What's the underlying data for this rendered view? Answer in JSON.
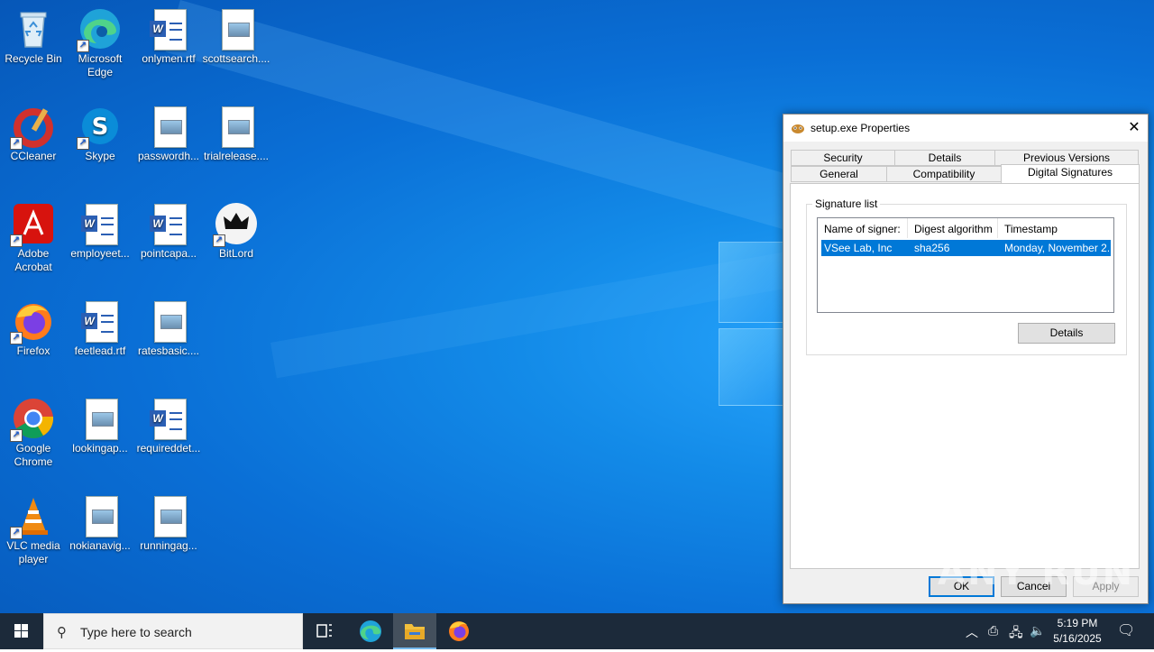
{
  "desktop": {
    "icons": [
      {
        "label": "Recycle Bin",
        "icon": "recycle-bin-icon"
      },
      {
        "label": "Microsoft Edge",
        "icon": "edge-icon"
      },
      {
        "label": "onlymen.rtf",
        "icon": "word-doc-icon"
      },
      {
        "label": "scottsearch....",
        "icon": "image-file-icon"
      },
      {
        "label": "CCleaner",
        "icon": "ccleaner-icon"
      },
      {
        "label": "Skype",
        "icon": "skype-icon"
      },
      {
        "label": "passwordh...",
        "icon": "image-file-icon"
      },
      {
        "label": "trialrelease....",
        "icon": "image-file-icon"
      },
      {
        "label": "Adobe Acrobat",
        "icon": "acrobat-icon"
      },
      {
        "label": "employeet...",
        "icon": "word-doc-icon"
      },
      {
        "label": "pointcapa...",
        "icon": "word-doc-icon"
      },
      {
        "label": "BitLord",
        "icon": "bitlord-icon"
      },
      {
        "label": "Firefox",
        "icon": "firefox-icon"
      },
      {
        "label": "feetlead.rtf",
        "icon": "word-doc-icon"
      },
      {
        "label": "ratesbasic....",
        "icon": "image-file-icon"
      },
      {
        "label": "Google Chrome",
        "icon": "chrome-icon"
      },
      {
        "label": "lookingap...",
        "icon": "image-file-icon"
      },
      {
        "label": "requireddet...",
        "icon": "word-doc-icon"
      },
      {
        "label": "VLC media player",
        "icon": "vlc-icon"
      },
      {
        "label": "nokianavig...",
        "icon": "image-file-icon"
      },
      {
        "label": "runningag...",
        "icon": "image-file-icon"
      }
    ]
  },
  "dialog": {
    "title": "setup.exe Properties",
    "close_glyph": "✕",
    "tabs_row1": [
      "Security",
      "Details",
      "Previous Versions"
    ],
    "tabs_row2": [
      "General",
      "Compatibility",
      "Digital Signatures"
    ],
    "active_tab": "Digital Signatures",
    "group_label": "Signature list",
    "columns": [
      "Name of signer:",
      "Digest algorithm",
      "Timestamp"
    ],
    "rows": [
      {
        "signer": "VSee Lab, Inc",
        "digest": "sha256",
        "timestamp": "Monday, November 2..."
      }
    ],
    "details_button": "Details",
    "ok_button": "OK",
    "cancel_button": "Cancel",
    "apply_button": "Apply"
  },
  "watermark": "ANY RUN",
  "taskbar": {
    "search_placeholder": "Type here to search",
    "time": "5:19 PM",
    "date": "5/16/2025"
  },
  "colors": {
    "selection": "#0078d7",
    "taskbar": "#1c2a3a",
    "desktop": "#0a6fd6"
  }
}
